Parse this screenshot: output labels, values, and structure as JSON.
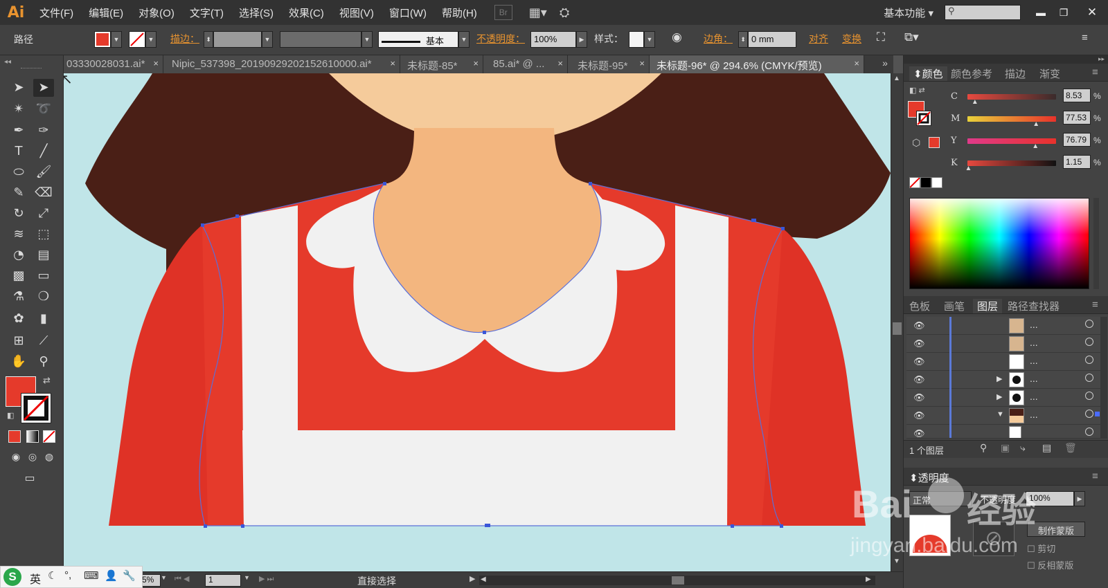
{
  "app": {
    "logo": "Ai",
    "workspace": "基本功能",
    "br": "Br"
  },
  "menu": [
    "文件(F)",
    "编辑(E)",
    "对象(O)",
    "文字(T)",
    "选择(S)",
    "效果(C)",
    "视图(V)",
    "窗口(W)",
    "帮助(H)"
  ],
  "control": {
    "object_type": "路径",
    "fill_color": "#e53a2b",
    "stroke_label": "描边：",
    "stroke_style": "基本",
    "opacity_label": "不透明度：",
    "opacity_value": "100%",
    "style_label": "样式：",
    "corner_label": "边角：",
    "corner_value": "0 mm",
    "align": "对齐",
    "transform": "变换"
  },
  "tabs": [
    {
      "label": "03330028031.ai*",
      "active": false
    },
    {
      "label": "Nipic_537398_20190929202152610000.ai*",
      "active": false
    },
    {
      "label": "未标题-85*",
      "active": false
    },
    {
      "label": "85.ai* @ ...",
      "active": false
    },
    {
      "label": "未标题-95*",
      "active": false
    },
    {
      "label": "未标题-96* @ 294.6% (CMYK/预览)",
      "active": true
    }
  ],
  "tab_close": "×",
  "canvas": {
    "bg": "#c0e5e8",
    "hair": "#4a1f16",
    "skin": "#f3b67f",
    "face": "#f5cb9b",
    "dress": "#e53a2b",
    "dress_side": "#df3226",
    "apron": "#f1f1f1"
  },
  "color_panel": {
    "tabs": [
      "颜色",
      "颜色参考",
      "描边",
      "渐变"
    ],
    "channels": [
      {
        "label": "C",
        "value": "8.53",
        "pct": 0.0853,
        "unit": "%"
      },
      {
        "label": "M",
        "value": "77.53",
        "pct": 0.7753,
        "unit": "%"
      },
      {
        "label": "Y",
        "value": "76.79",
        "pct": 0.7679,
        "unit": "%"
      },
      {
        "label": "K",
        "value": "1.15",
        "pct": 0.0115,
        "unit": "%"
      }
    ]
  },
  "layers_panel": {
    "tabs": [
      "色板",
      "画笔",
      "图层",
      "路径查找器"
    ],
    "rows": [
      "...",
      "...",
      "...",
      "...",
      "...",
      "...",
      "..."
    ],
    "count": "1 个图层"
  },
  "transparency_panel": {
    "title": "透明度",
    "mode": "正常",
    "opacity_label": "不透明度",
    "opacity_value": "100%",
    "make_mask": "制作蒙版",
    "clip": "剪切",
    "invert": "反相蒙版"
  },
  "status": {
    "zoom": "5%",
    "page": "1",
    "tool": "直接选择"
  },
  "ime": {
    "lang": "英",
    "logo": "S"
  },
  "watermark": {
    "brand_a": "Bai",
    "brand_b": "经验",
    "url": "jingyan.baidu.com"
  }
}
